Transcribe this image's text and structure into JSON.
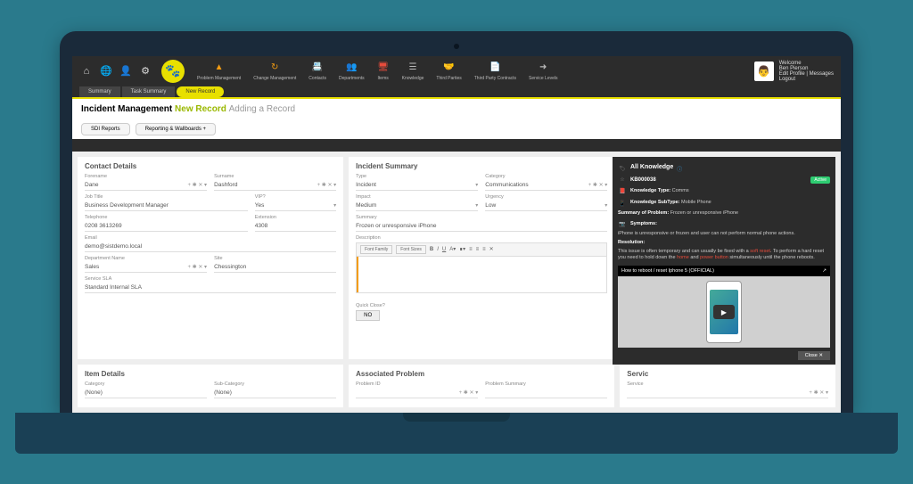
{
  "nav": {
    "items": [
      {
        "label": "Problem Management"
      },
      {
        "label": "Change Management"
      },
      {
        "label": "Contacts"
      },
      {
        "label": "Departments"
      },
      {
        "label": "Items"
      },
      {
        "label": "Knowledge"
      },
      {
        "label": "Third Parties"
      },
      {
        "label": "Third Party Contracts"
      },
      {
        "label": "Service Levels"
      }
    ]
  },
  "user": {
    "welcome": "Welcome",
    "name": "Ben Pierson",
    "links": "Edit Profile | Messages",
    "logout": "Logout"
  },
  "tabs": {
    "summary": "Summary",
    "task": "Task Summary",
    "new": "New Record"
  },
  "title": {
    "main": "Incident Management",
    "new": "New Record",
    "sub": "Adding a Record"
  },
  "reports": {
    "sdi": "SDI Reports",
    "wall": "Reporting & Wallboards  +"
  },
  "contact": {
    "heading": "Contact Details",
    "forename_l": "Forename",
    "forename": "Dane",
    "surname_l": "Surname",
    "surname": "Dashford",
    "job_l": "Job Title",
    "job": "Business Development Manager",
    "vip_l": "VIP?",
    "vip": "Yes",
    "tel_l": "Telephone",
    "tel": "0208 3613269",
    "ext_l": "Extension",
    "ext": "4308",
    "email_l": "Email",
    "email": "demo@sistdemo.local",
    "dept_l": "Department Name",
    "dept": "Sales",
    "site_l": "Site",
    "site": "Chessington",
    "sla_l": "Service SLA",
    "sla": "Standard Internal SLA"
  },
  "incident": {
    "heading": "Incident Summary",
    "type_l": "Type",
    "type": "Incident",
    "cat_l": "Category",
    "cat": "Communications",
    "impact_l": "Impact",
    "impact": "Medium",
    "urgency_l": "Urgency",
    "urgency": "Low",
    "summary_l": "Summary",
    "summary": "Frozen or unresponsive iPhone",
    "desc_l": "Description",
    "ff": "Font Family",
    "fs": "Font Sizes",
    "qc_l": "Quick Close?",
    "qc": "NO"
  },
  "item": {
    "heading": "Item Details",
    "cat_l": "Category",
    "cat": "(None)",
    "sub_l": "Sub-Category",
    "sub": "(None)"
  },
  "assoc": {
    "heading": "Associated Problem",
    "pid_l": "Problem ID",
    "psum_l": "Problem Summary"
  },
  "service": {
    "heading": "Servic",
    "sl": "Service"
  },
  "kb": {
    "all": "All Knowledge",
    "id": "KB000038",
    "badge": "Active",
    "type_l": "Knowledge Type:",
    "type": "Comms",
    "subtype_l": "Knowledge SubType:",
    "subtype": "Mobile Phone",
    "sop_l": "Summary of Problem:",
    "sop": "Frozen or unresponsive iPhone",
    "symptoms_l": "Symptoms:",
    "symptoms": "iPhone is unresponsive or frozen and user can not perform normal phone actions.",
    "res_l": "Resolution:",
    "res1": "This issue is often temporary and can usually be fixed with a ",
    "res_hl1": "soft reset",
    "res2": ". To perform a hard reset you need to hold down the ",
    "res_hl2": "home",
    "res3": " and ",
    "res_hl3": "power button",
    "res4": " simultaneously until the phone reboots.",
    "video": "How to reboot / reset Iphone 5 (OFFICIAL)",
    "close": "Close ✕"
  }
}
